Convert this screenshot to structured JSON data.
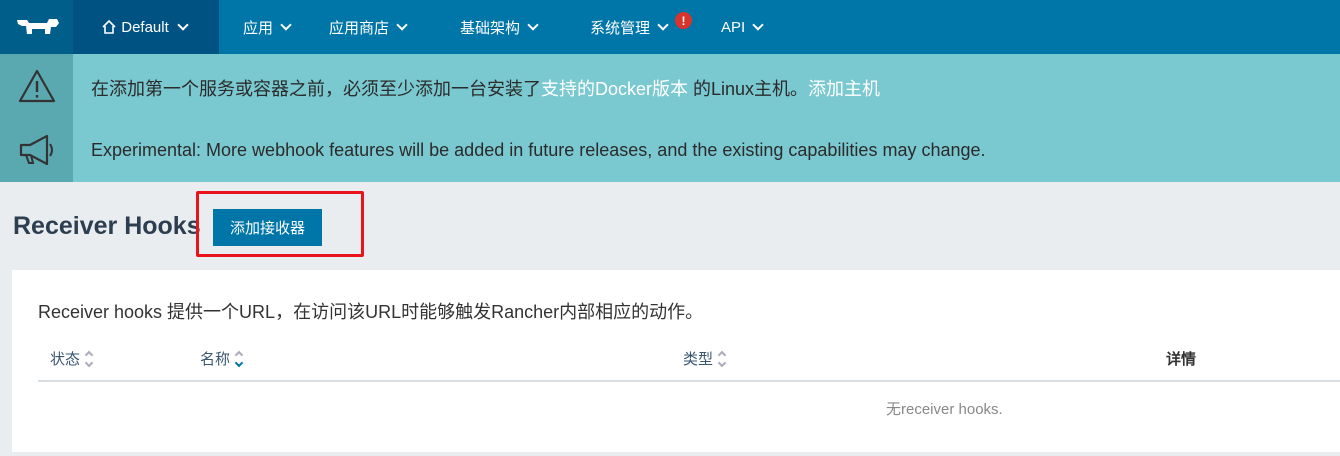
{
  "nav": {
    "env_label": "Default",
    "items": [
      {
        "label": "应用"
      },
      {
        "label": "应用商店"
      },
      {
        "label": "基础架构"
      },
      {
        "label": "系统管理",
        "alert": "!"
      },
      {
        "label": "API"
      }
    ]
  },
  "banners": {
    "host_warning": {
      "prefix": "在添加第一个服务或容器之前，必须至少添加一台安装了",
      "link_docker": "支持的Docker版本",
      "middle": " 的Linux主机。",
      "link_add_host": "添加主机"
    },
    "experimental": "Experimental: More webhook features will be added in future releases, and the existing capabilities may change."
  },
  "page": {
    "title": "Receiver Hooks",
    "add_button": "添加接收器"
  },
  "card": {
    "description": "Receiver hooks 提供一个URL，在访问该URL时能够触发Rancher内部相应的动作。",
    "columns": [
      "状态",
      "名称",
      "类型",
      "详情"
    ],
    "empty_text": "无receiver hooks."
  },
  "colors": {
    "nav_bg": "#0075a8",
    "banner_bg": "#7ac8d0",
    "button_bg": "#0075a8",
    "highlight": "#e8141b"
  }
}
